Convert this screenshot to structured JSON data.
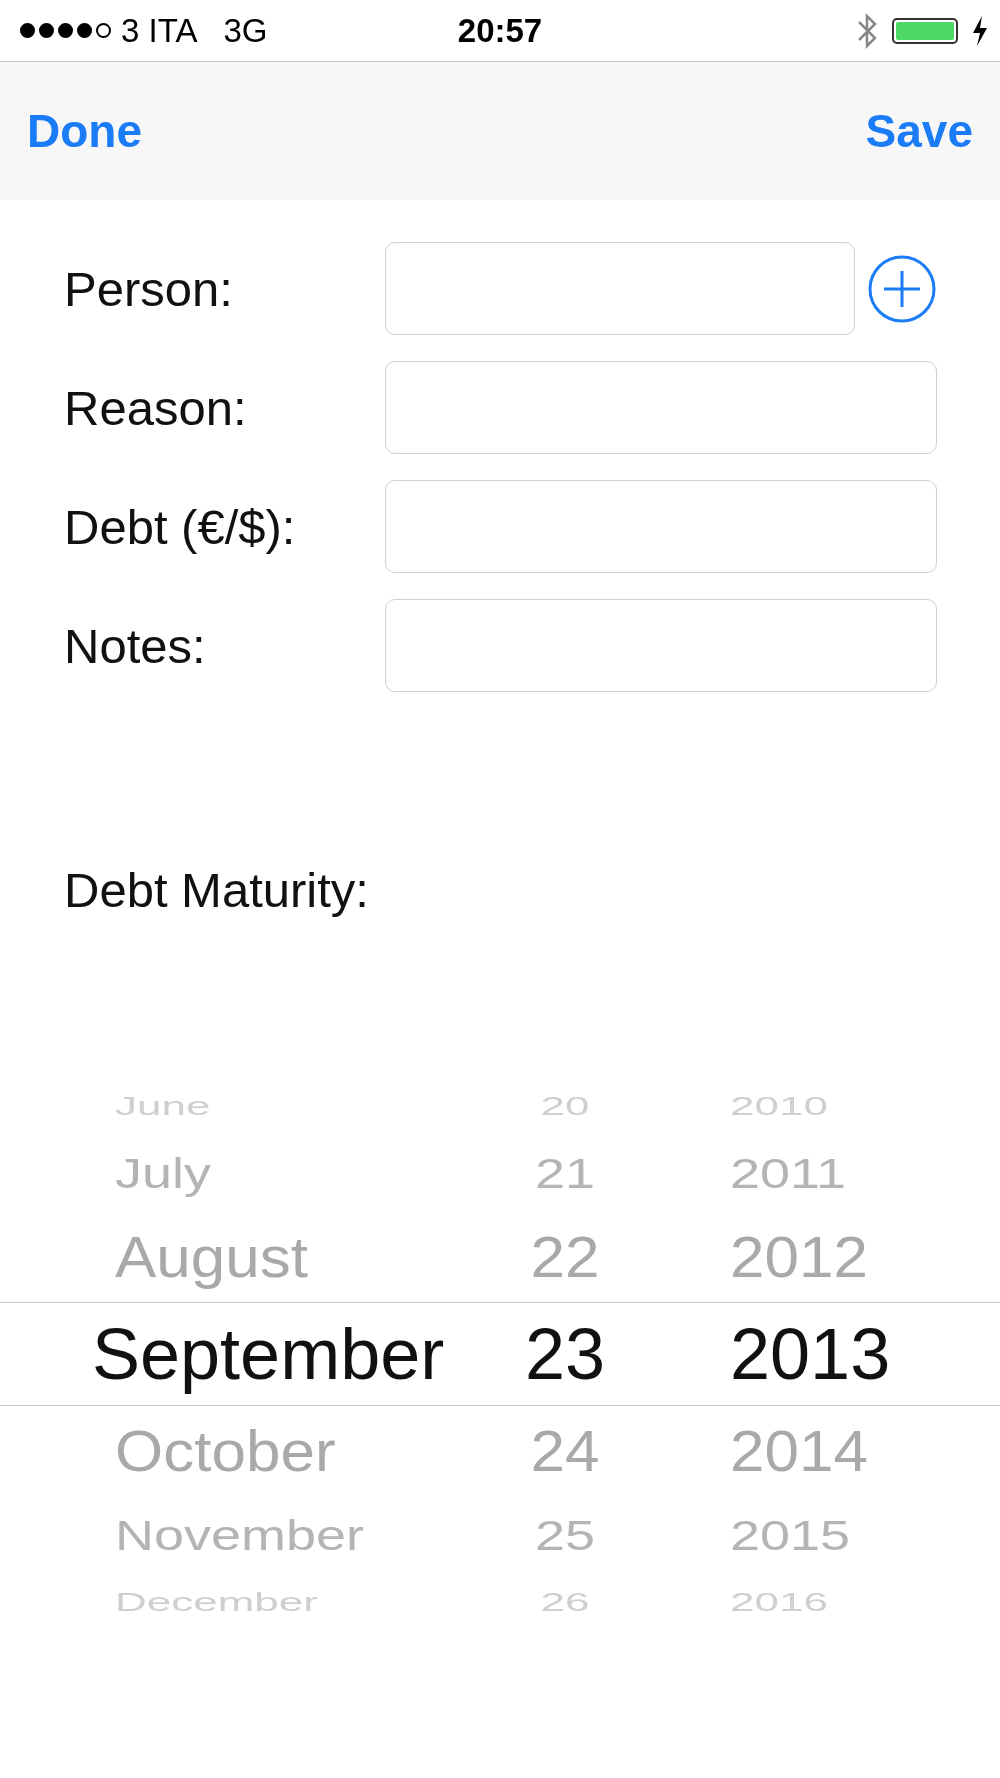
{
  "status_bar": {
    "carrier": "3 ITA",
    "network": "3G",
    "time": "20:57"
  },
  "nav_bar": {
    "left_button": "Done",
    "right_button": "Save"
  },
  "form": [
    {
      "label": "Person:",
      "add_button": true
    },
    {
      "label": "Reason:",
      "add_button": false
    },
    {
      "label": "Debt (€/$):",
      "add_button": false
    },
    {
      "label": "Notes:",
      "add_button": false
    }
  ],
  "maturity_label": "Debt Maturity:",
  "date_picker": {
    "rows": [
      {
        "month": "June",
        "day": "20",
        "year": "2010",
        "selected": false
      },
      {
        "month": "July",
        "day": "21",
        "year": "2011",
        "selected": false
      },
      {
        "month": "August",
        "day": "22",
        "year": "2012",
        "selected": false
      },
      {
        "month": "September",
        "day": "23",
        "year": "2013",
        "selected": true
      },
      {
        "month": "October",
        "day": "24",
        "year": "2014",
        "selected": false
      },
      {
        "month": "November",
        "day": "25",
        "year": "2015",
        "selected": false
      },
      {
        "month": "December",
        "day": "26",
        "year": "2016",
        "selected": false
      }
    ]
  }
}
